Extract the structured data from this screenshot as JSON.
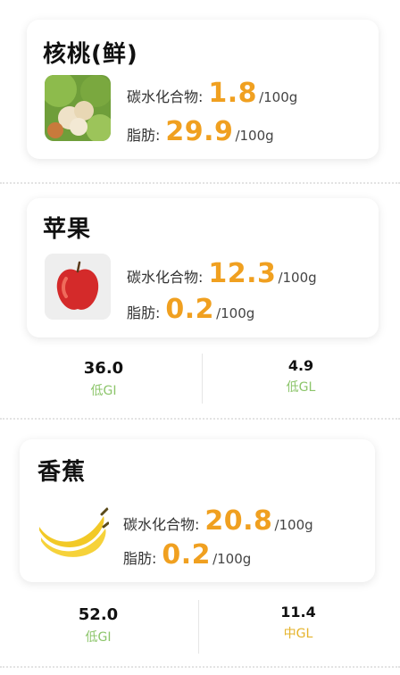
{
  "colors": {
    "value_orange": "#f0a020",
    "low_green": "#8cc56a",
    "mid_yellow": "#e5b32a"
  },
  "foods": [
    {
      "name": "核桃(鲜)",
      "image_icon": "walnut-photo",
      "carb_label": "碳水化合物:",
      "carb_value": "1.8",
      "carb_unit": "/100g",
      "fat_label": "脂肪:",
      "fat_value": "29.9",
      "fat_unit": "/100g"
    },
    {
      "name": "苹果",
      "image_icon": "apple-photo",
      "carb_label": "碳水化合物:",
      "carb_value": "12.3",
      "carb_unit": "/100g",
      "fat_label": "脂肪:",
      "fat_value": "0.2",
      "fat_unit": "/100g",
      "gi_value": "36.0",
      "gi_label": "低GI",
      "gl_value": "4.9",
      "gl_label": "低GL"
    },
    {
      "name": "香蕉",
      "image_icon": "banana-photo",
      "carb_label": "碳水化合物:",
      "carb_value": "20.8",
      "carb_unit": "/100g",
      "fat_label": "脂肪:",
      "fat_value": "0.2",
      "fat_unit": "/100g",
      "gi_value": "52.0",
      "gi_label": "低GI",
      "gl_value": "11.4",
      "gl_label": "中GL"
    }
  ]
}
